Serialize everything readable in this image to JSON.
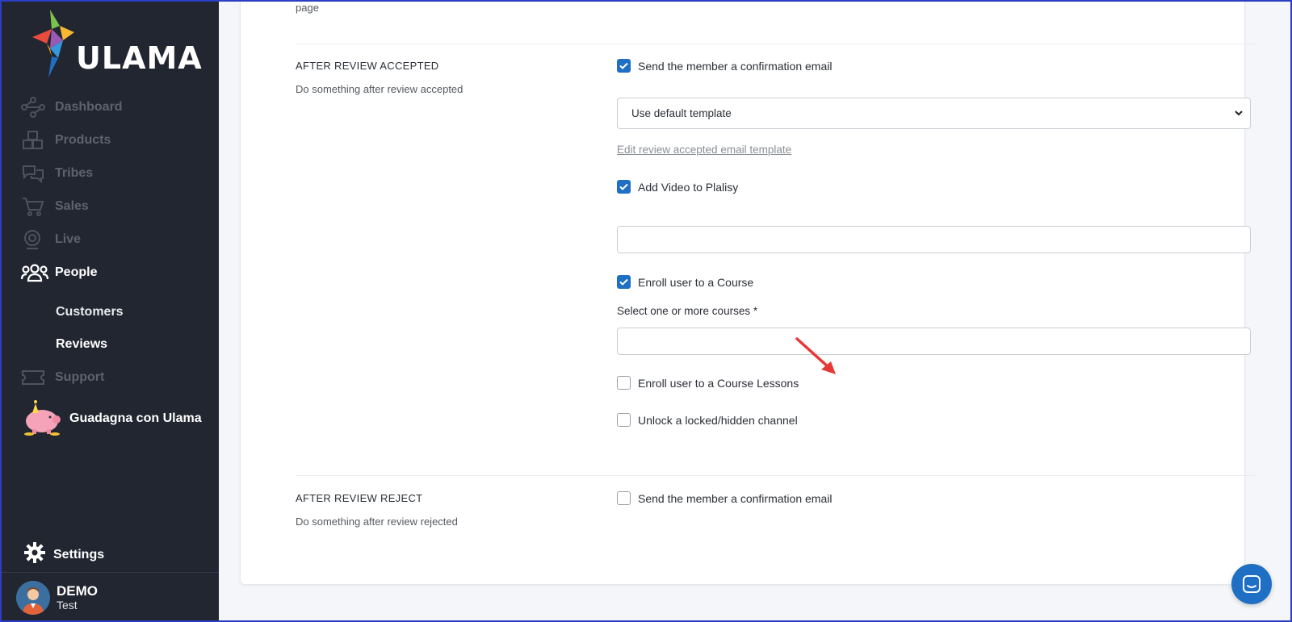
{
  "brand": {
    "name": "ULAMA"
  },
  "sidebar": {
    "items": [
      {
        "label": "Dashboard",
        "icon": "network-icon"
      },
      {
        "label": "Products",
        "icon": "boxes-icon"
      },
      {
        "label": "Tribes",
        "icon": "chat-bubbles-icon"
      },
      {
        "label": "Sales",
        "icon": "cart-icon"
      },
      {
        "label": "Live",
        "icon": "webcam-icon"
      },
      {
        "label": "People",
        "icon": "people-icon",
        "active": true
      },
      {
        "label": "Support",
        "icon": "ticket-icon"
      }
    ],
    "sub_items": [
      {
        "label": "Customers"
      },
      {
        "label": "Reviews",
        "current": true
      }
    ],
    "promo": {
      "label": "Guadagna con Ulama",
      "icon": "piggy-bank-icon"
    },
    "settings": {
      "label": "Settings",
      "icon": "gear-icon"
    },
    "user": {
      "name": "DEMO",
      "subtitle": "Test"
    }
  },
  "content": {
    "page_fragment": "page",
    "after_review_accepted": {
      "title": "AFTER REVIEW ACCEPTED",
      "description": "Do something after review accepted",
      "send_email": {
        "label": "Send the member a confirmation email",
        "checked": true
      },
      "template_select": {
        "value": "Use default template"
      },
      "edit_link": "Edit review accepted email template",
      "add_video": {
        "label": "Add Video to Plalisy",
        "checked": true
      },
      "video_input": {
        "value": ""
      },
      "enroll_course": {
        "label": "Enroll user to a Course",
        "checked": true
      },
      "courses_label": "Select one or more courses *",
      "courses_input": {
        "value": ""
      },
      "enroll_lessons": {
        "label": "Enroll user to a Course Lessons",
        "checked": false
      },
      "unlock_channel": {
        "label": "Unlock a locked/hidden channel",
        "checked": false
      }
    },
    "after_review_reject": {
      "title": "AFTER REVIEW REJECT",
      "description": "Do something after review rejected",
      "send_email": {
        "label": "Send the member a confirmation email",
        "checked": false
      }
    }
  },
  "colors": {
    "sidebar_bg": "#222630",
    "accent": "#1f6fc5",
    "annotation_arrow": "#e53935"
  }
}
